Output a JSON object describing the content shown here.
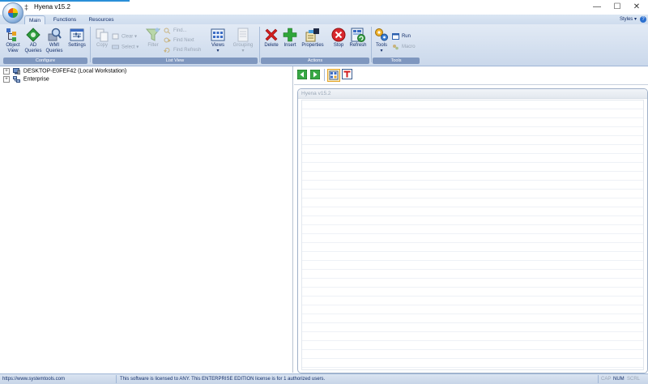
{
  "window": {
    "title": "Hyena v15.2",
    "pin_glyph": "‡",
    "minimize": "—",
    "maximize": "☐",
    "close": "✕"
  },
  "tabs": [
    {
      "label": "Main",
      "active": true
    },
    {
      "label": "Functions",
      "active": false
    },
    {
      "label": "Resources",
      "active": false
    }
  ],
  "styles_label": "Styles ▾",
  "help_glyph": "?",
  "ribbon": {
    "configure": {
      "label": "Configure",
      "object_view": [
        "Object",
        "View"
      ],
      "ad_queries": [
        "AD",
        "Queries"
      ],
      "wmi_queries": [
        "WMI",
        "Queries"
      ],
      "settings": "Settings"
    },
    "list_view": {
      "label": "List View",
      "copy": "Copy",
      "clear": "Clear ▾",
      "select": "Select ▾",
      "filter": "Filter",
      "find": "Find...",
      "find_next": "Find Next",
      "find_refresh": "Find Refresh",
      "views": "Views",
      "views_arrow": "▾",
      "grouping": "Grouping",
      "grouping_arrow": "▾"
    },
    "actions": {
      "label": "Actions",
      "delete": "Delete",
      "insert": "Insert",
      "properties": "Properties",
      "stop": "Stop",
      "refresh": "Refresh"
    },
    "tools": {
      "label": "Tools",
      "tools": "Tools",
      "tools_arrow": "▾",
      "run": "Run",
      "macro": "Macro"
    }
  },
  "tree": {
    "items": [
      {
        "label": "DESKTOP-E0FEF42 (Local Workstation)",
        "expander": "+"
      },
      {
        "label": "Enterprise",
        "expander": "+"
      }
    ]
  },
  "panel": {
    "header": "Hyena v15.2"
  },
  "status": {
    "url": "https://www.systemtools.com",
    "license": "This software is licensed to ANY. This ENTERPRISE EDITION license is for 1 authorized users.",
    "cap": "CAP",
    "num": "NUM",
    "scrl": "SCRL"
  }
}
